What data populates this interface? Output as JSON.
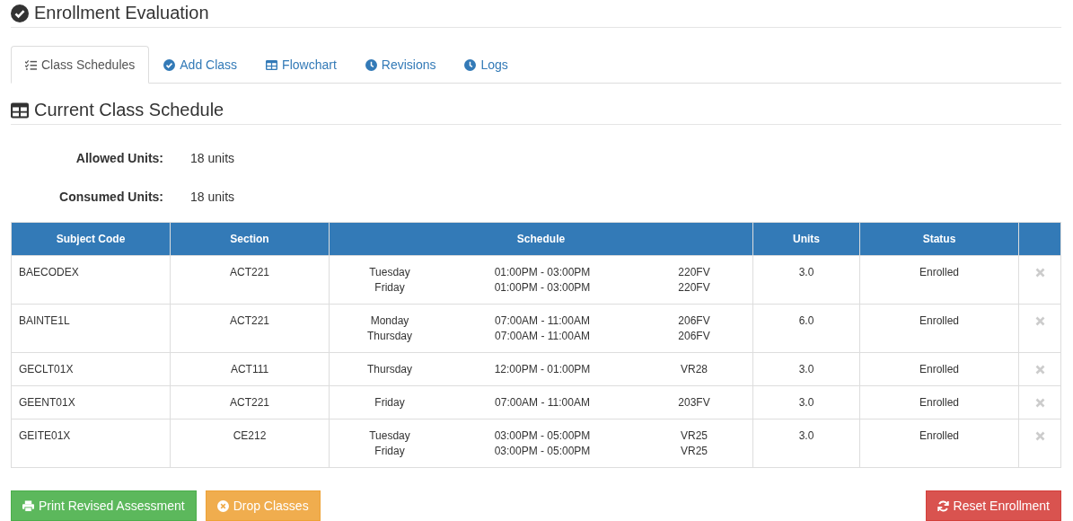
{
  "header": {
    "title": "Enrollment Evaluation"
  },
  "tabs": [
    {
      "label": "Class Schedules",
      "selected": true
    },
    {
      "label": "Add Class",
      "selected": false
    },
    {
      "label": "Flowchart",
      "selected": false
    },
    {
      "label": "Revisions",
      "selected": false
    },
    {
      "label": "Logs",
      "selected": false
    }
  ],
  "section": {
    "title": "Current Class Schedule"
  },
  "units": [
    {
      "label": "Allowed Units:",
      "value": "18 units"
    },
    {
      "label": "Consumed Units:",
      "value": "18 units"
    }
  ],
  "table": {
    "columns": [
      "Subject Code",
      "Section",
      "Schedule",
      "Units",
      "Status"
    ],
    "rows": [
      {
        "subject_code": "BAECODEX",
        "section": "ACT221",
        "schedule": [
          {
            "day": "Tuesday",
            "time": "01:00PM - 03:00PM",
            "room": "220FV"
          },
          {
            "day": "Friday",
            "time": "01:00PM - 03:00PM",
            "room": "220FV"
          }
        ],
        "units": "3.0",
        "status": "Enrolled"
      },
      {
        "subject_code": "BAINTE1L",
        "section": "ACT221",
        "schedule": [
          {
            "day": "Monday",
            "time": "07:00AM - 11:00AM",
            "room": "206FV"
          },
          {
            "day": "Thursday",
            "time": "07:00AM - 11:00AM",
            "room": "206FV"
          }
        ],
        "units": "6.0",
        "status": "Enrolled"
      },
      {
        "subject_code": "GECLT01X",
        "section": "ACT111",
        "schedule": [
          {
            "day": "Thursday",
            "time": "12:00PM - 01:00PM",
            "room": "VR28"
          }
        ],
        "units": "3.0",
        "status": "Enrolled"
      },
      {
        "subject_code": "GEENT01X",
        "section": "ACT221",
        "schedule": [
          {
            "day": "Friday",
            "time": "07:00AM - 11:00AM",
            "room": "203FV"
          }
        ],
        "units": "3.0",
        "status": "Enrolled"
      },
      {
        "subject_code": "GEITE01X",
        "section": "CE212",
        "schedule": [
          {
            "day": "Tuesday",
            "time": "03:00PM - 05:00PM",
            "room": "VR25"
          },
          {
            "day": "Friday",
            "time": "03:00PM - 05:00PM",
            "room": "VR25"
          }
        ],
        "units": "3.0",
        "status": "Enrolled"
      }
    ]
  },
  "buttons": [
    {
      "label": "Print Revised Assessment",
      "kind": "success"
    },
    {
      "label": "Drop Classes",
      "kind": "warning"
    },
    {
      "label": "Reset Enrollment",
      "kind": "danger"
    }
  ]
}
